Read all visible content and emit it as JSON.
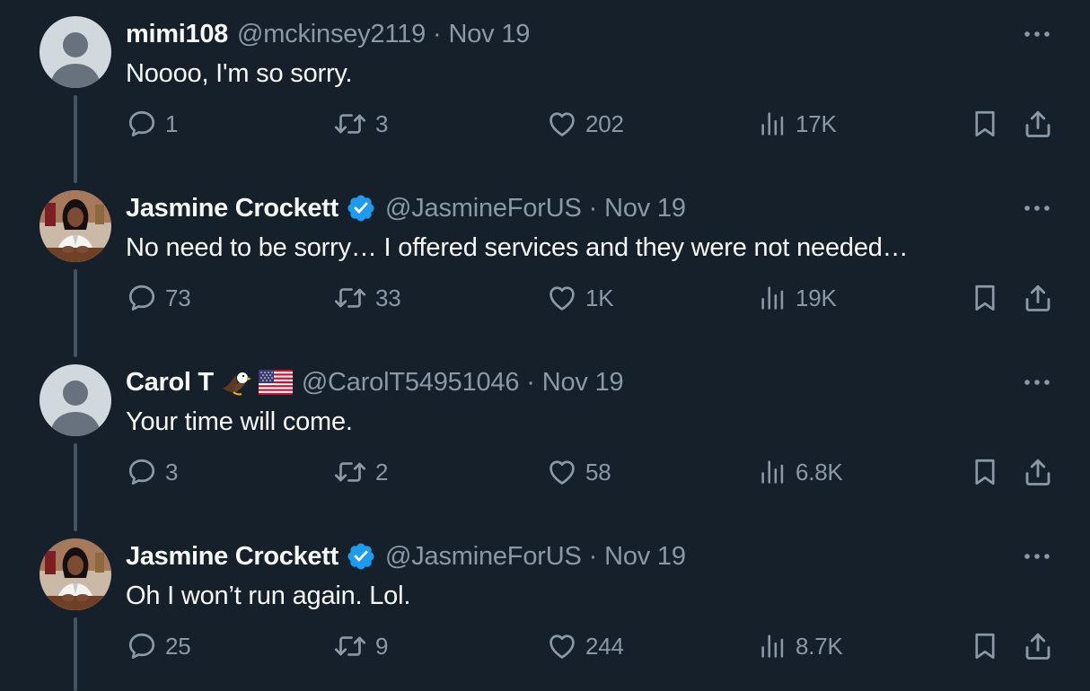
{
  "tweets": [
    {
      "display_name": "mimi108",
      "handle": "@mckinsey2119",
      "separator": "·",
      "date": "Nov 19",
      "verified": false,
      "emojis": [],
      "avatar": "default-avatar",
      "text": "Noooo, I'm so sorry.",
      "replies": "1",
      "retweets": "3",
      "likes": "202",
      "views": "17K"
    },
    {
      "display_name": "Jasmine Crockett",
      "handle": "@JasmineForUS",
      "separator": "·",
      "date": "Nov 19",
      "verified": true,
      "emojis": [],
      "avatar": "photo-avatar",
      "text": "No need to be sorry… I offered services and they were not needed…",
      "replies": "73",
      "retweets": "33",
      "likes": "1K",
      "views": "19K"
    },
    {
      "display_name": "Carol T",
      "handle": "@CarolT54951046",
      "separator": "·",
      "date": "Nov 19",
      "verified": false,
      "emojis": [
        "eagle-emoji",
        "us-flag-emoji"
      ],
      "avatar": "default-avatar",
      "text": "Your time will come.",
      "replies": "3",
      "retweets": "2",
      "likes": "58",
      "views": "6.8K"
    },
    {
      "display_name": "Jasmine Crockett",
      "handle": "@JasmineForUS",
      "separator": "·",
      "date": "Nov 19",
      "verified": true,
      "emojis": [],
      "avatar": "photo-avatar",
      "text": "Oh I won’t run again. Lol.",
      "replies": "25",
      "retweets": "9",
      "likes": "244",
      "views": "8.7K"
    }
  ],
  "colors": {
    "background": "#15202b",
    "text_primary": "#f7f9f9",
    "text_secondary": "#8b98a5",
    "thread_line": "#425364",
    "verified_badge": "#1d9bf0"
  },
  "icons": {
    "reply": "reply-icon",
    "retweet": "retweet-icon",
    "like": "heart-icon",
    "views": "views-icon",
    "bookmark": "bookmark-icon",
    "share": "share-icon",
    "more": "more-icon"
  }
}
